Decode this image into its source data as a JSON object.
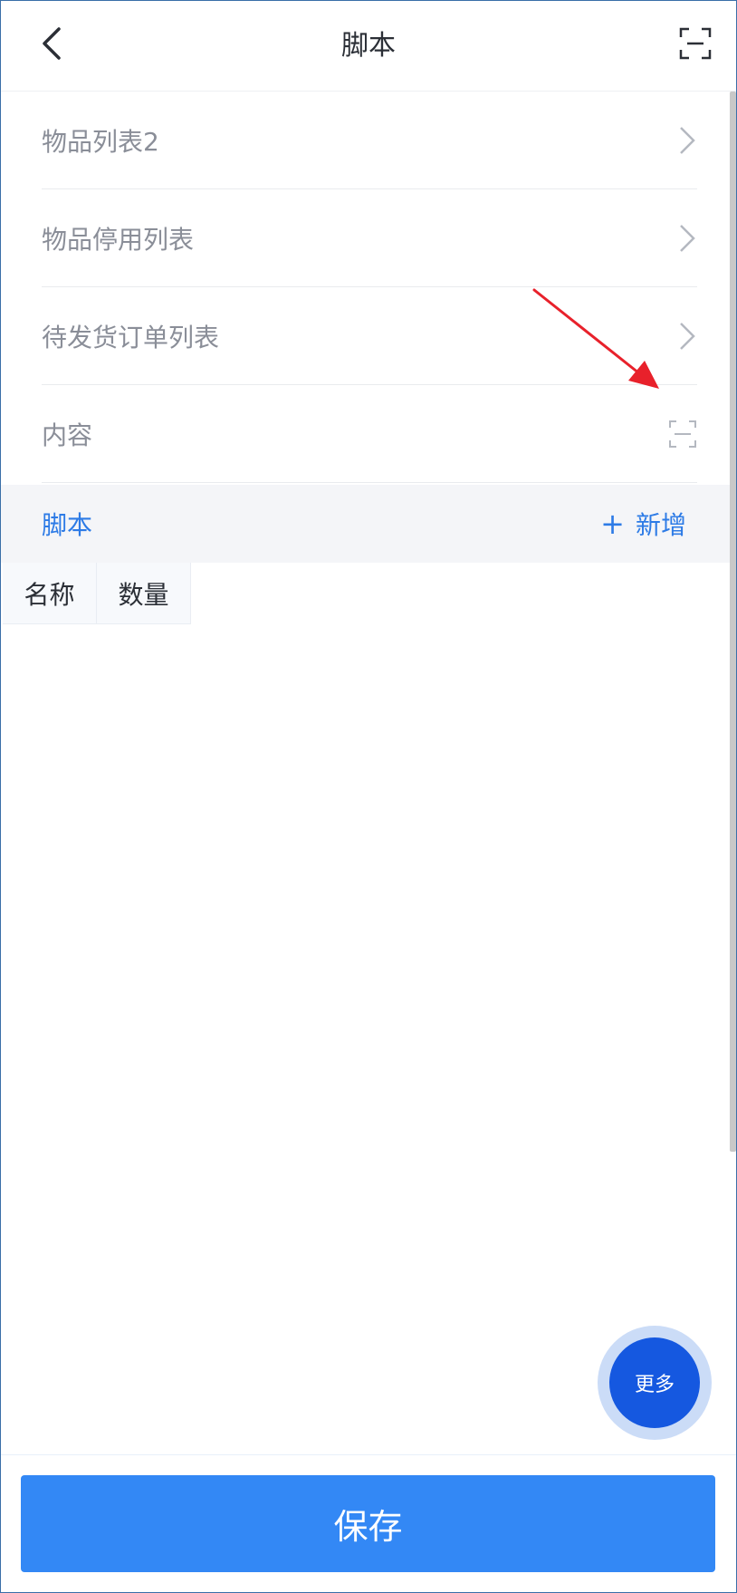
{
  "header": {
    "title": "脚本",
    "back_icon": "chevron-left-icon",
    "scan_icon": "scan-icon"
  },
  "form": {
    "rows": [
      {
        "label": "物品列表2",
        "accessory": "chevron-right-icon"
      },
      {
        "label": "物品停用列表",
        "accessory": "chevron-right-icon"
      },
      {
        "label": "待发货订单列表",
        "accessory": "chevron-right-icon"
      },
      {
        "label": "内容",
        "accessory": "scan-icon"
      }
    ]
  },
  "section": {
    "title": "脚本",
    "add_label": "新增",
    "add_symbol": "+"
  },
  "table": {
    "columns": [
      "名称",
      "数量"
    ]
  },
  "fab": {
    "label": "更多"
  },
  "footer": {
    "save_label": "保存"
  },
  "colors": {
    "accent": "#2d7be6",
    "save_button": "#3388f5",
    "fab": "#1558e0",
    "annotation_arrow": "#e8212b"
  }
}
